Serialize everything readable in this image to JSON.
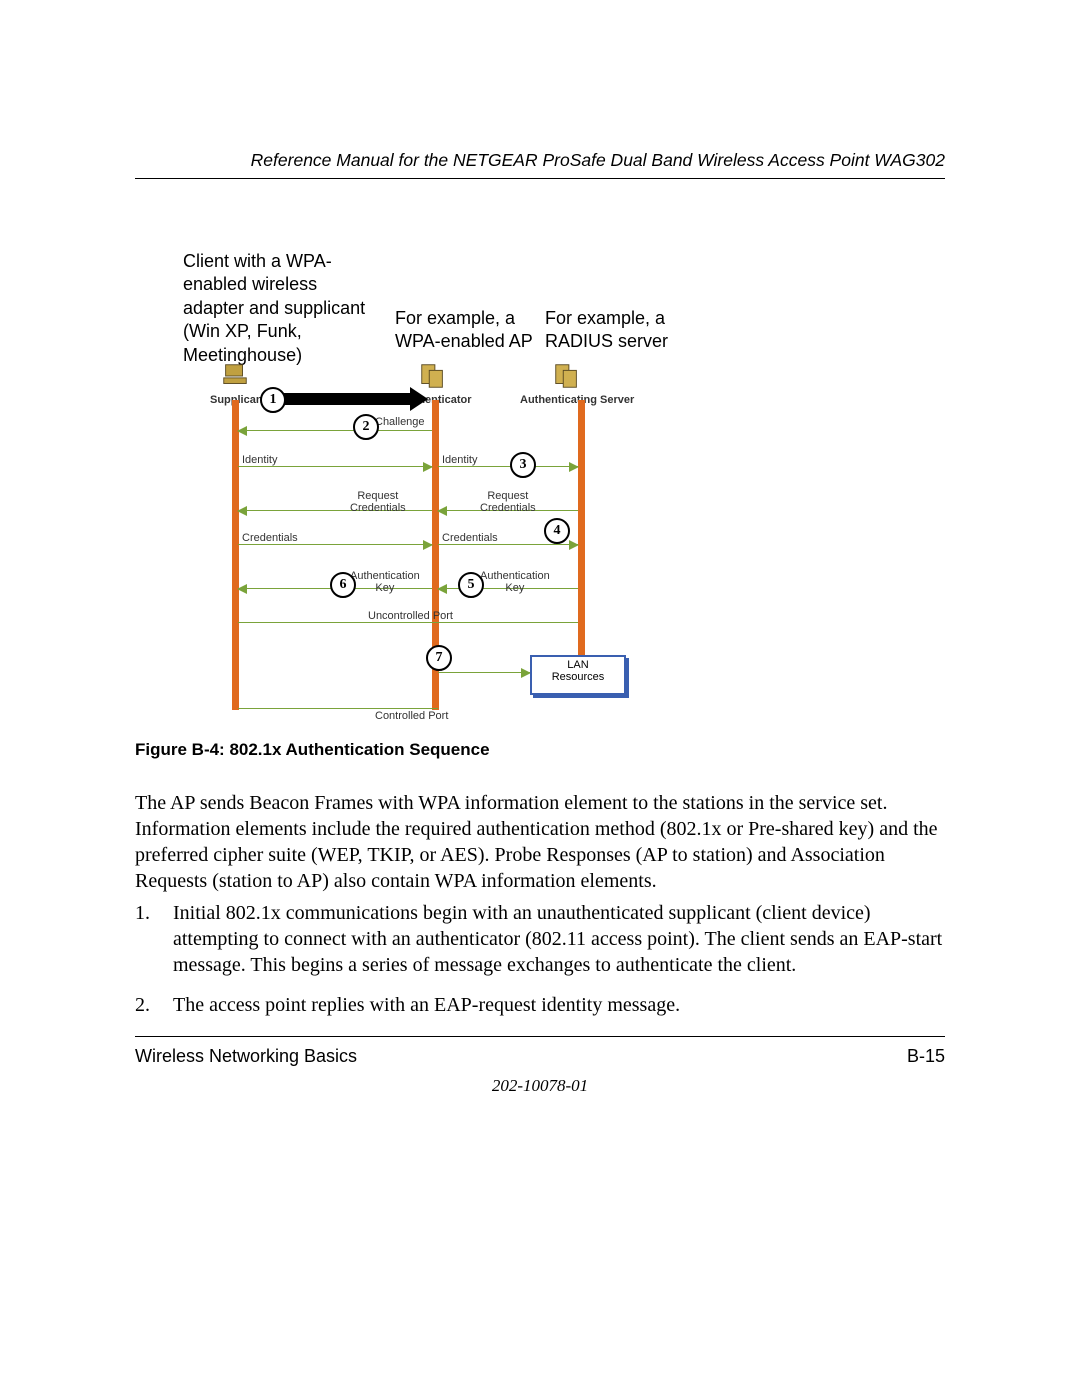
{
  "header": {
    "title": "Reference Manual for the NETGEAR ProSafe Dual Band Wireless Access Point WAG302"
  },
  "descriptions": {
    "supplicant": "Client with a WPA-enabled wireless adapter and supplicant (Win XP, Funk, Meetinghouse)",
    "authenticator": "For example, a WPA-enabled AP",
    "server": "For example, a RADIUS server"
  },
  "diagram": {
    "actors": {
      "supplicant_label": "Supplicant",
      "authenticator_label": "Authenticator",
      "server_label": "Authenticating Server"
    },
    "steps": {
      "1": "1",
      "2": "2",
      "3": "3",
      "4": "4",
      "5": "5",
      "6": "6",
      "7": "7"
    },
    "messages": {
      "challenge": "Challenge",
      "identity_left": "Identity",
      "identity_right": "Identity",
      "request_left": "Request\nCredentials",
      "request_right": "Request\nCredentials",
      "credentials_left": "Credentials",
      "credentials_right": "Credentials",
      "authkey_left": "Authentication\nKey",
      "authkey_right": "Authentication\nKey"
    },
    "ports": {
      "uncontrolled": "Uncontrolled Port",
      "controlled": "Controlled Port"
    },
    "lan_resources": "LAN\nResources"
  },
  "figure_caption": "Figure B-4:  802.1x Authentication Sequence",
  "paragraph": "The AP sends Beacon Frames with WPA information element to the stations in the service set. Information elements include the required authentication method (802.1x or Pre-shared key) and the preferred cipher suite (WEP, TKIP, or AES). Probe Responses (AP to station) and Association Requests (station to AP) also contain WPA information elements.",
  "list": {
    "item1_num": "1.",
    "item1_text": "Initial 802.1x communications begin with an unauthenticated supplicant (client device) attempting to connect with an authenticator (802.11 access point). The client sends an EAP-start message. This begins a series of message exchanges to authenticate the client.",
    "item2_num": "2.",
    "item2_text": "The access point replies with an EAP-request identity message."
  },
  "footer": {
    "left": "Wireless Networking Basics",
    "right": "B-15",
    "doc": "202-10078-01"
  }
}
